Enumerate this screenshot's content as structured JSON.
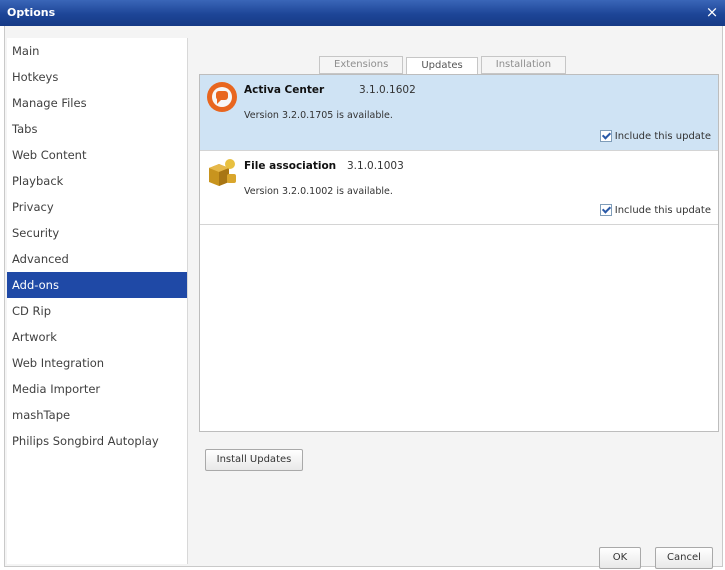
{
  "window": {
    "title": "Options",
    "close_symbol": "×"
  },
  "sidebar": {
    "selected_index": 10,
    "items": [
      {
        "label": "Main"
      },
      {
        "label": "Hotkeys"
      },
      {
        "label": "Manage Files"
      },
      {
        "label": "Tabs"
      },
      {
        "label": "Web Content"
      },
      {
        "label": "Playback"
      },
      {
        "label": "Privacy"
      },
      {
        "label": "Security"
      },
      {
        "label": "Advanced"
      },
      {
        "label": "Add-ons"
      },
      {
        "label": "CD Rip"
      },
      {
        "label": "Artwork"
      },
      {
        "label": "Web Integration"
      },
      {
        "label": "Media Importer"
      },
      {
        "label": "mashTape"
      },
      {
        "label": "Philips Songbird Autoplay"
      }
    ]
  },
  "tabs": [
    {
      "label": "Extensions"
    },
    {
      "label": "Updates"
    },
    {
      "label": "Installation"
    }
  ],
  "active_tab": "Updates",
  "updates": [
    {
      "name": "Activa Center",
      "version": "3.1.0.1602",
      "description": "Version 3.2.0.1705 is available.",
      "include_label": "Include this update",
      "included": true,
      "icon": "activa-center-icon"
    },
    {
      "name": "File association",
      "version": "3.1.0.1003",
      "description": "Version 3.2.0.1002 is available.",
      "include_label": "Include this update",
      "included": true,
      "icon": "file-association-icon"
    }
  ],
  "buttons": {
    "install": "Install Updates",
    "ok": "OK",
    "cancel": "Cancel"
  }
}
